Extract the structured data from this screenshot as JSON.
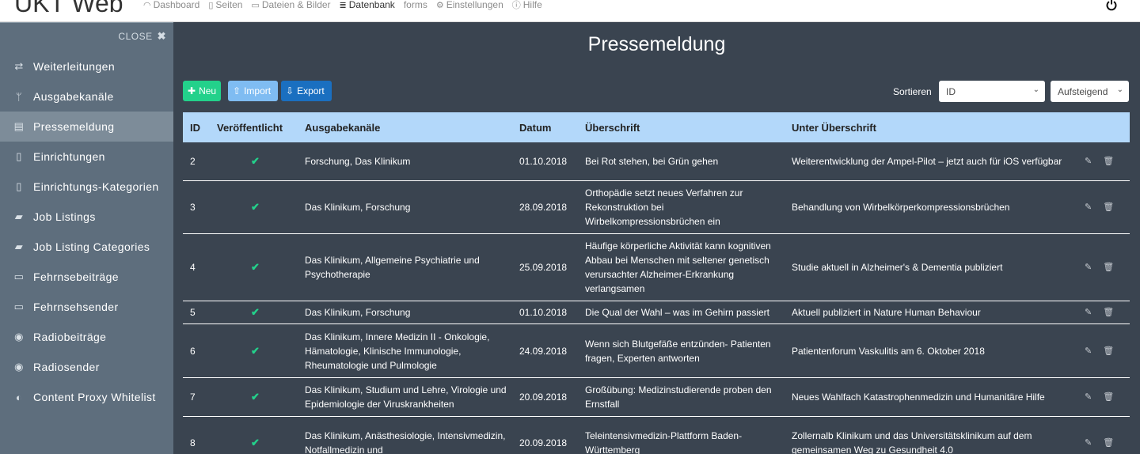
{
  "app": {
    "brand": "UKT Web"
  },
  "topnav": [
    {
      "icon": "dashboard-icon",
      "glyph": "◠",
      "label": "Dashboard",
      "active": false
    },
    {
      "icon": "pages-icon",
      "glyph": "▯",
      "label": "Seiten",
      "active": false
    },
    {
      "icon": "files-icon",
      "glyph": "▭",
      "label": "Dateien & Bilder",
      "active": false
    },
    {
      "icon": "database-icon",
      "glyph": "≣",
      "label": "Datenbank",
      "active": true
    },
    {
      "icon": "",
      "glyph": "",
      "label": "forms",
      "active": false
    },
    {
      "icon": "gear-icon",
      "glyph": "⚙",
      "label": "Einstellungen",
      "active": false
    },
    {
      "icon": "info-icon",
      "glyph": "ⓘ",
      "label": "Hilfe",
      "active": false
    }
  ],
  "sidebar": {
    "close_label": "CLOSE",
    "items": [
      {
        "icon": "retweet-icon",
        "glyph": "⇄",
        "label": "Weiterleitungen",
        "active": false
      },
      {
        "icon": "fork-icon",
        "glyph": "ᛘ",
        "label": "Ausgabekanäle",
        "active": false
      },
      {
        "icon": "newspaper-icon",
        "glyph": "▤",
        "label": "Pressemeldung",
        "active": true
      },
      {
        "icon": "building-icon",
        "glyph": "▯",
        "label": "Einrichtungen",
        "active": false
      },
      {
        "icon": "building-icon",
        "glyph": "▯",
        "label": "Einrichtungs-Kategorien",
        "active": false
      },
      {
        "icon": "briefcase-icon",
        "glyph": "▰",
        "label": "Job Listings",
        "active": false
      },
      {
        "icon": "briefcase-icon",
        "glyph": "▰",
        "label": "Job Listing Categories",
        "active": false
      },
      {
        "icon": "monitor-icon",
        "glyph": "▭",
        "label": "Fehrnsebeiträge",
        "active": false
      },
      {
        "icon": "monitor-icon",
        "glyph": "▭",
        "label": "Fehrnsehsender",
        "active": false
      },
      {
        "icon": "podcast-icon",
        "glyph": "◉",
        "label": "Radiobeiträge",
        "active": false
      },
      {
        "icon": "podcast-icon",
        "glyph": "◉",
        "label": "Radiosender",
        "active": false
      },
      {
        "icon": "shield-icon",
        "glyph": "◐",
        "label": "Content Proxy Whitelist",
        "active": false
      }
    ]
  },
  "main": {
    "title": "Pressemeldung",
    "toolbar": {
      "new_label": "Neu",
      "import_label": "Import",
      "export_label": "Export"
    },
    "sort": {
      "label": "Sortieren",
      "field": "ID",
      "order": "Aufsteigend"
    }
  },
  "table": {
    "columns": [
      "ID",
      "Veröffentlicht",
      "Ausgabekanäle",
      "Datum",
      "Überschrift",
      "Unter Überschrift"
    ],
    "rows": [
      {
        "id": "2",
        "published": true,
        "channels": "Forschung, Das Klinikum",
        "date": "01.10.2018",
        "title": "Bei Rot stehen, bei Grün gehen",
        "subtitle": "Weiterentwicklung der Ampel-Pilot – jetzt auch für iOS verfügbar"
      },
      {
        "id": "3",
        "published": true,
        "channels": "Das Klinikum, Forschung",
        "date": "28.09.2018",
        "title": "Orthopädie setzt neues Verfahren zur Rekonstruktion bei Wirbelkompressionsbrüchen ein",
        "subtitle": "Behandlung von Wirbelkörperkompressionsbrüchen"
      },
      {
        "id": "4",
        "published": true,
        "channels": "Das Klinikum, Allgemeine Psychiatrie und Psychotherapie",
        "date": "25.09.2018",
        "title": "Häufige körperliche Aktivität kann kognitiven Abbau bei Menschen mit seltener genetisch verursachter Alzheimer-Erkrankung verlangsamen",
        "subtitle": "Studie aktuell in Alzheimer's & Dementia publiziert"
      },
      {
        "id": "5",
        "published": true,
        "channels": "Das Klinikum, Forschung",
        "date": "01.10.2018",
        "title": "Die Qual der Wahl – was im Gehirn passiert",
        "subtitle": "Aktuell publiziert in Nature Human Behaviour"
      },
      {
        "id": "6",
        "published": true,
        "channels": "Das Klinikum, Innere Medizin II - Onkologie, Hämatologie, Klinische Immunologie, Rheumatologie und Pulmologie",
        "date": "24.09.2018",
        "title": "Wenn sich Blutgefäße entzünden- Patienten fragen, Experten antworten",
        "subtitle": "Patientenforum Vaskulitis am 6. Oktober 2018"
      },
      {
        "id": "7",
        "published": true,
        "channels": "Das Klinikum, Studium und Lehre, Virologie und Epidemiologie der Viruskrankheiten",
        "date": "20.09.2018",
        "title": "Großübung: Medizinstudierende proben den Ernstfall",
        "subtitle": "Neues Wahlfach Katastrophenmedizin und Humanitäre Hilfe"
      },
      {
        "id": "8",
        "published": true,
        "channels": "Das Klinikum, Anästhesiologie, Intensivmedizin, Notfallmedizin und",
        "date": "20.09.2018",
        "title": "Teleintensivmedizin-Plattform Baden-Württemberg",
        "subtitle": "Zollernalb Klinikum und das Universitätsklinikum auf dem gemeinsamen Weg zu Gesundheit 4.0"
      }
    ]
  },
  "colors": {
    "sidebar": "#5e6e7d",
    "main": "#3a4450",
    "header": "#b3d8fa",
    "success": "#23d18b"
  }
}
